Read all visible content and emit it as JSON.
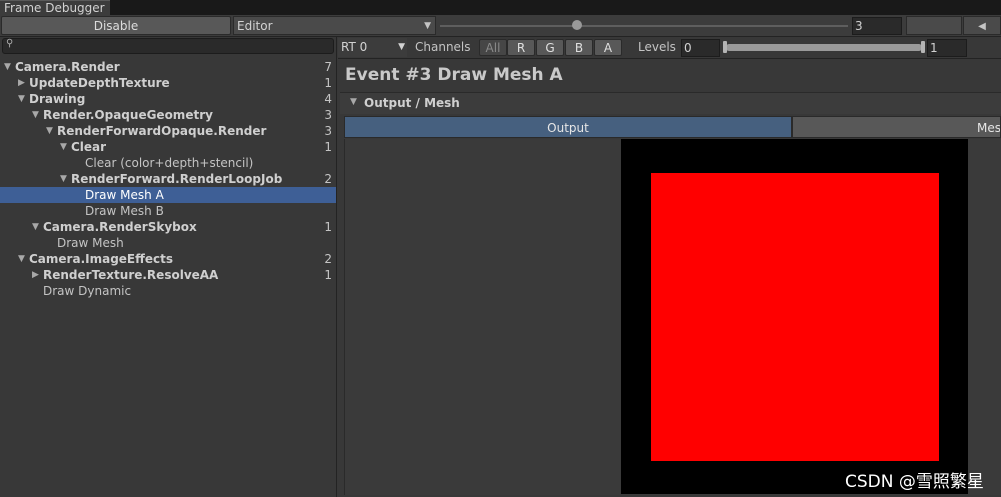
{
  "window": {
    "tab_title": "Frame Debugger"
  },
  "toolbar": {
    "disable_label": "Disable",
    "target_label": "Editor",
    "event_index": "3"
  },
  "search": {
    "placeholder": ""
  },
  "tree": [
    {
      "label": "Camera.Render",
      "count": "7",
      "bold": true,
      "expanded": true
    },
    {
      "label": "UpdateDepthTexture",
      "count": "1",
      "bold": true,
      "expanded": false
    },
    {
      "label": "Drawing",
      "count": "4",
      "bold": true,
      "expanded": true
    },
    {
      "label": "Render.OpaqueGeometry",
      "count": "3",
      "bold": true,
      "expanded": true
    },
    {
      "label": "RenderForwardOpaque.Render",
      "count": "3",
      "bold": true,
      "expanded": true
    },
    {
      "label": "Clear",
      "count": "1",
      "bold": true,
      "expanded": true
    },
    {
      "label": "Clear (color+depth+stencil)",
      "count": "",
      "bold": false
    },
    {
      "label": "RenderForward.RenderLoopJob",
      "count": "2",
      "bold": true,
      "expanded": true
    },
    {
      "label": "Draw Mesh A",
      "count": "",
      "bold": false,
      "selected": true
    },
    {
      "label": "Draw Mesh B",
      "count": "",
      "bold": false
    },
    {
      "label": "Camera.RenderSkybox",
      "count": "1",
      "bold": true,
      "expanded": true
    },
    {
      "label": "Draw Mesh",
      "count": "",
      "bold": false
    },
    {
      "label": "Camera.ImageEffects",
      "count": "2",
      "bold": true,
      "expanded": true
    },
    {
      "label": "RenderTexture.ResolveAA",
      "count": "1",
      "bold": true,
      "expanded": false
    },
    {
      "label": "Draw Dynamic",
      "count": "",
      "bold": false
    }
  ],
  "rt": {
    "label": "RT 0"
  },
  "channels": {
    "label": "Channels",
    "all": "All",
    "r": "R",
    "g": "G",
    "b": "B",
    "a": "A"
  },
  "levels": {
    "label": "Levels",
    "min": "0",
    "max": "1"
  },
  "event": {
    "title": "Event #3 Draw Mesh A"
  },
  "foldout": {
    "label": "Output / Mesh"
  },
  "view_tabs": {
    "output": "Output",
    "mesh": "Mesh"
  },
  "colors": {
    "mesh": "#ff0000",
    "selection": "#3e5f96",
    "output_tab": "#46607f"
  },
  "watermark": "CSDN @雪照繁星"
}
